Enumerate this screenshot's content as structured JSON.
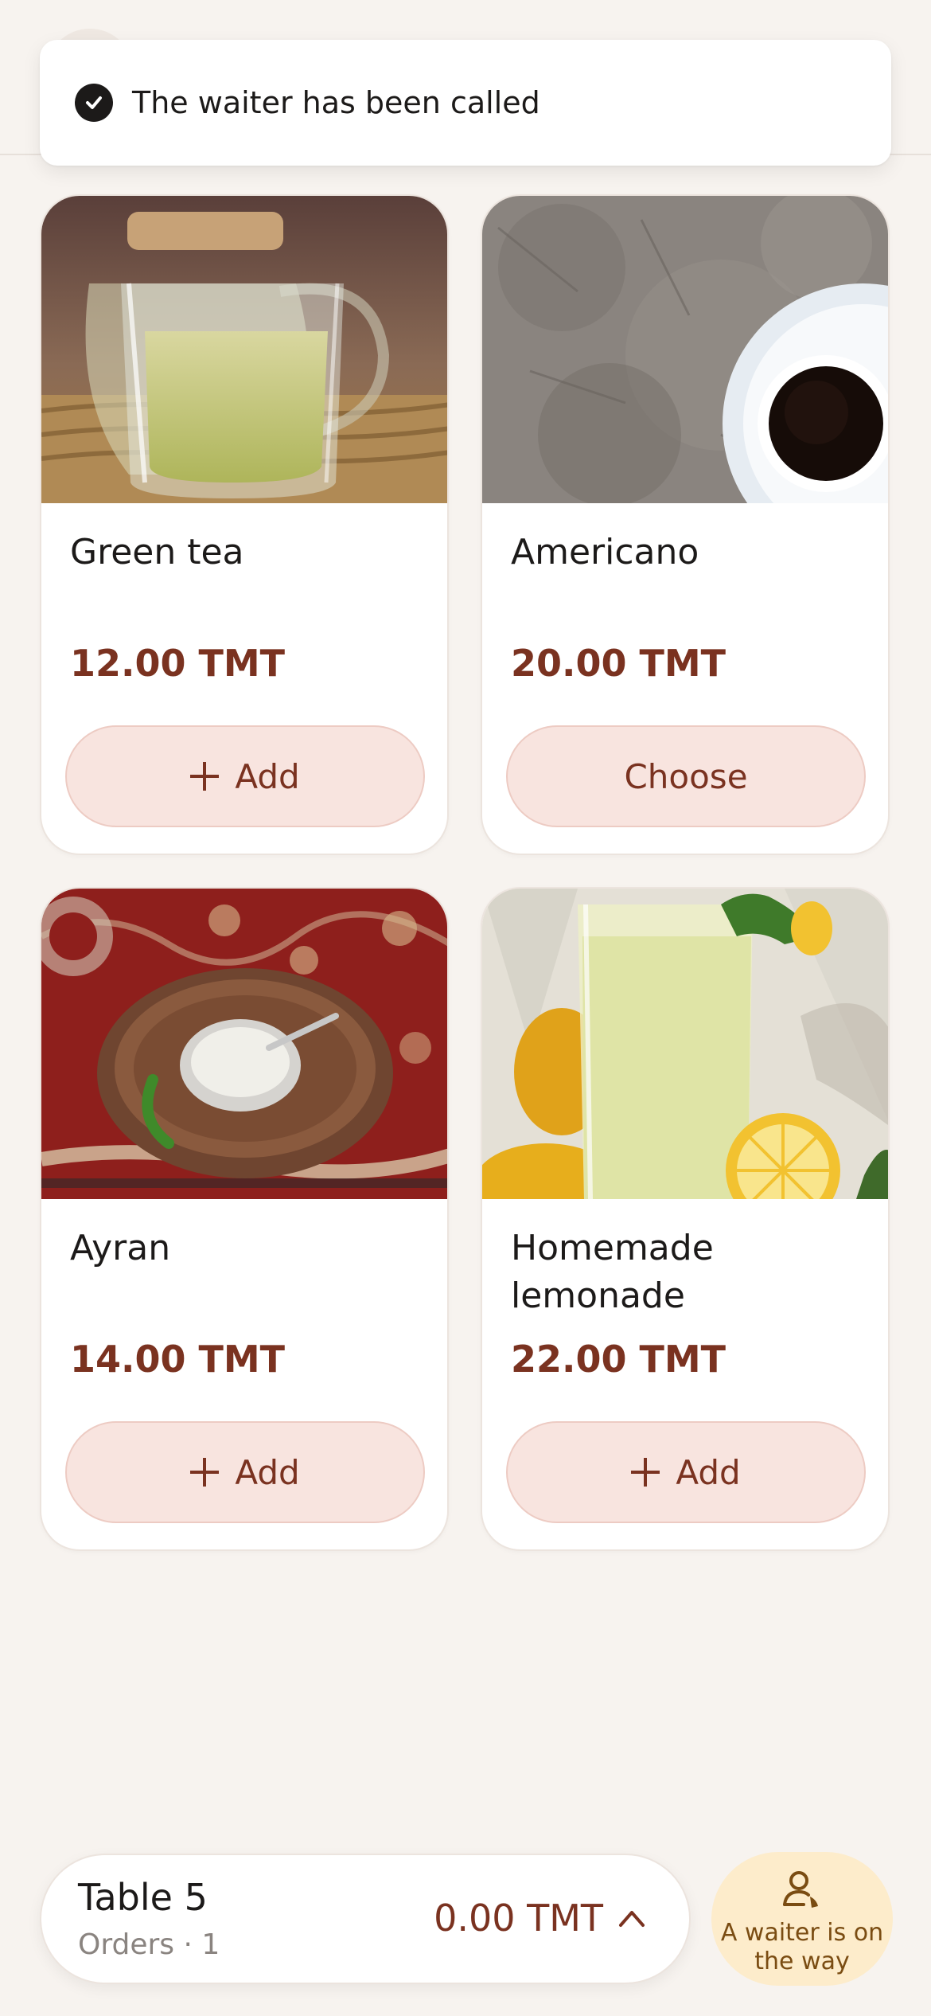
{
  "toast": {
    "message": "The waiter has been called",
    "icon": "check-circle-icon"
  },
  "products": [
    {
      "name": "Green tea",
      "price": "12.00 TMT",
      "button": "Add",
      "button_icon": "plus-icon"
    },
    {
      "name": "Americano",
      "price": "20.00 TMT",
      "button": "Choose"
    },
    {
      "name": "Ayran",
      "price": "14.00 TMT",
      "button": "Add",
      "button_icon": "plus-icon"
    },
    {
      "name": "Homemade lemonade",
      "price": "22.00 TMT",
      "button": "Add",
      "button_icon": "plus-icon"
    }
  ],
  "bottom_bar": {
    "table": "Table 5",
    "orders": "Orders · 1",
    "total": "0.00 TMT",
    "icon": "chevron-up-icon"
  },
  "waiter_status": {
    "label": "A waiter is on the way",
    "icon": "waiter-bell-icon"
  },
  "colors": {
    "accent": "#7a3220",
    "button_bg": "#f8e4df",
    "waiter_bg": "#fdeccb",
    "page_bg": "#f7f3ef"
  }
}
